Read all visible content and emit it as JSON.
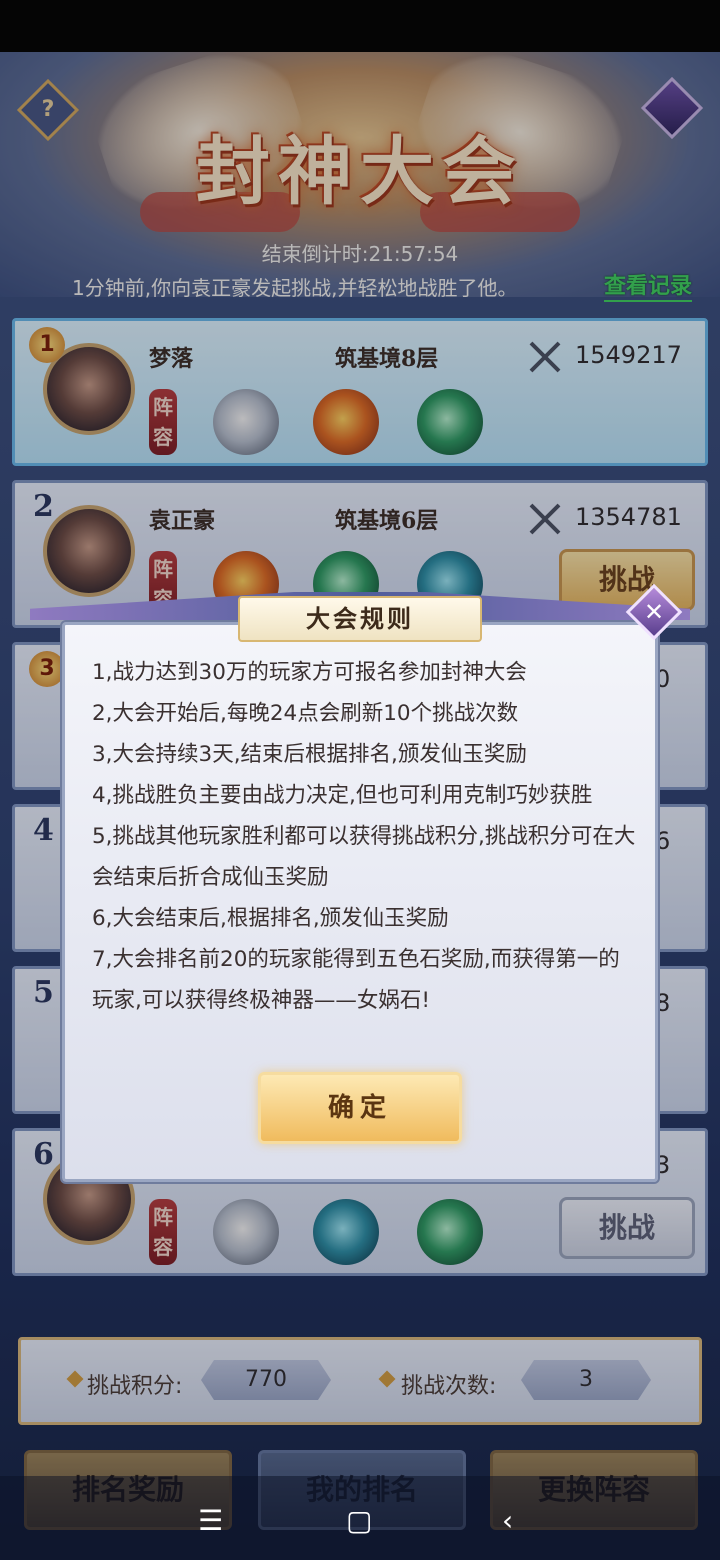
{
  "header": {
    "title": "封神大会",
    "countdown": "结束倒计时:21:57:54",
    "message": "1分钟前,你向袁正豪发起挑战,并轻松地战胜了他。",
    "view_record": "查看记录",
    "help_symbol": "?"
  },
  "rows": [
    {
      "rank": "1",
      "name": "梦落",
      "realm": "筑基境8层",
      "power": "1549217",
      "lineup": "阵容",
      "beasts": [
        "tiger",
        "gold-dragon",
        "green-dragon"
      ],
      "button": ""
    },
    {
      "rank": "2",
      "name": "袁正豪",
      "realm": "筑基境6层",
      "power": "1354781",
      "lineup": "阵容",
      "beasts": [
        "gold-dragon",
        "green-dragon",
        "teal-dragon"
      ],
      "button": "挑战"
    },
    {
      "rank": "3",
      "power_tail": "0"
    },
    {
      "rank": "4",
      "power_tail": "6"
    },
    {
      "rank": "5",
      "power_tail": "8"
    },
    {
      "rank": "6",
      "power_tail": "3",
      "lineup": "阵容",
      "button": "挑战"
    }
  ],
  "bottom": {
    "points_label": "挑战积分:",
    "points_value": "770",
    "count_label": "挑战次数:",
    "count_value": "3"
  },
  "nav": {
    "rank_reward": "排名奖励",
    "my_rank": "我的排名",
    "change_lineup": "更换阵容"
  },
  "dialog": {
    "title": "大会规则",
    "close_symbol": "✕",
    "rules": [
      "1,战力达到30万的玩家方可报名参加封神大会",
      "2,大会开始后,每晚24点会刷新10个挑战次数",
      "3,大会持续3天,结束后根据排名,颁发仙玉奖励",
      "4,挑战胜负主要由战力决定,但也可利用克制巧妙获胜",
      "5,挑战其他玩家胜利都可以获得挑战积分,挑战积分可在大会结束后折合成仙玉奖励",
      "6,大会结束后,根据排名,颁发仙玉奖励",
      "7,大会排名前20的玩家能得到五色石奖励,而获得第一的玩家,可以获得终极神器——女娲石!"
    ],
    "confirm": "确定"
  },
  "system_nav": {
    "menu": "☰",
    "home": "▢",
    "back": "‹"
  }
}
